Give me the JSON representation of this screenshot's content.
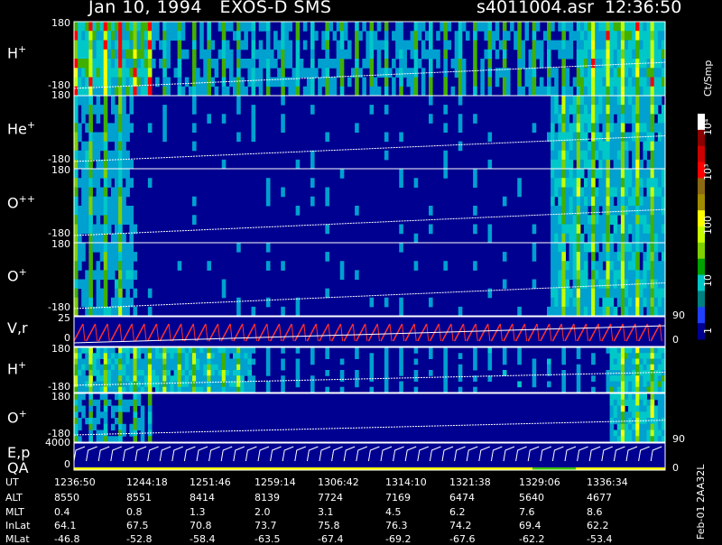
{
  "header": {
    "title_left": "Jan 10, 1994   EXOS-D SMS",
    "title_right": "s4011004.asr  12:36:50"
  },
  "panels": [
    {
      "label": "H",
      "sup": "+",
      "ymax": "180",
      "ymin": "-180"
    },
    {
      "label": "He",
      "sup": "+",
      "ymax": "180",
      "ymin": "-180"
    },
    {
      "label": "O",
      "sup": "++",
      "ymax": "180",
      "ymin": "-180"
    },
    {
      "label": "O",
      "sup": "+",
      "ymax": "180",
      "ymin": "-180"
    },
    {
      "label": "V,r",
      "sup": "",
      "ymax": "25",
      "ymin": "0",
      "right_tick": "90",
      "right_tick2": "0"
    },
    {
      "label": "H",
      "sup": "+",
      "ymax": "180",
      "ymin": "-180"
    },
    {
      "label": "O",
      "sup": "+",
      "ymax": "180",
      "ymin": "-180",
      "right_tick": "90"
    },
    {
      "label": "E,p",
      "sup": "",
      "label2": "QA",
      "ymax": "4000",
      "ymin": "0",
      "right_tick": "0"
    }
  ],
  "colorbar": {
    "title": "Ct/Smp",
    "ticks": [
      "10⁴",
      "10³",
      "100",
      "10",
      "1"
    ],
    "colors": [
      "#ffffff",
      "#8b0000",
      "#cc0000",
      "#ff0000",
      "#8b6914",
      "#a08c00",
      "#ffff00",
      "#c8ff00",
      "#7fd000",
      "#00a000",
      "#00c8c8",
      "#008080",
      "#2040ff",
      "#000090"
    ]
  },
  "footer": {
    "side_label": "Feb-01 2AA32L",
    "rows": [
      {
        "name": "UT",
        "values": [
          "1236:50",
          "1244:18",
          "1251:46",
          "1259:14",
          "1306:42",
          "1314:10",
          "1321:38",
          "1329:06",
          "1336:34"
        ]
      },
      {
        "name": "ALT",
        "values": [
          "8550",
          "8551",
          "8414",
          "8139",
          "7724",
          "7169",
          "6474",
          "5640",
          "4677"
        ]
      },
      {
        "name": "MLT",
        "values": [
          "0.4",
          "0.8",
          "1.3",
          "2.0",
          "3.1",
          "4.5",
          "6.2",
          "7.6",
          "8.6"
        ]
      },
      {
        "name": "InLat",
        "values": [
          "64.1",
          "67.5",
          "70.8",
          "73.7",
          "75.8",
          "76.3",
          "74.2",
          "69.4",
          "62.2"
        ]
      },
      {
        "name": "MLat",
        "values": [
          "-46.8",
          "-52.8",
          "-58.4",
          "-63.5",
          "-67.4",
          "-69.2",
          "-67.6",
          "-62.2",
          "-53.4"
        ]
      }
    ]
  },
  "chart_data": {
    "type": "heatmap",
    "x_ticks": [
      "1236:50",
      "1244:18",
      "1251:46",
      "1259:14",
      "1306:42",
      "1314:10",
      "1321:38",
      "1329:06",
      "1336:34"
    ],
    "colors": {
      "background": "#000090",
      "low": "#2050ff",
      "mid": "#00c0c0",
      "green": "#40c000",
      "yellow": "#ffff00",
      "red": "#ff0000",
      "trace": "#ffffff",
      "vel_trace": "#ff3030"
    }
  }
}
